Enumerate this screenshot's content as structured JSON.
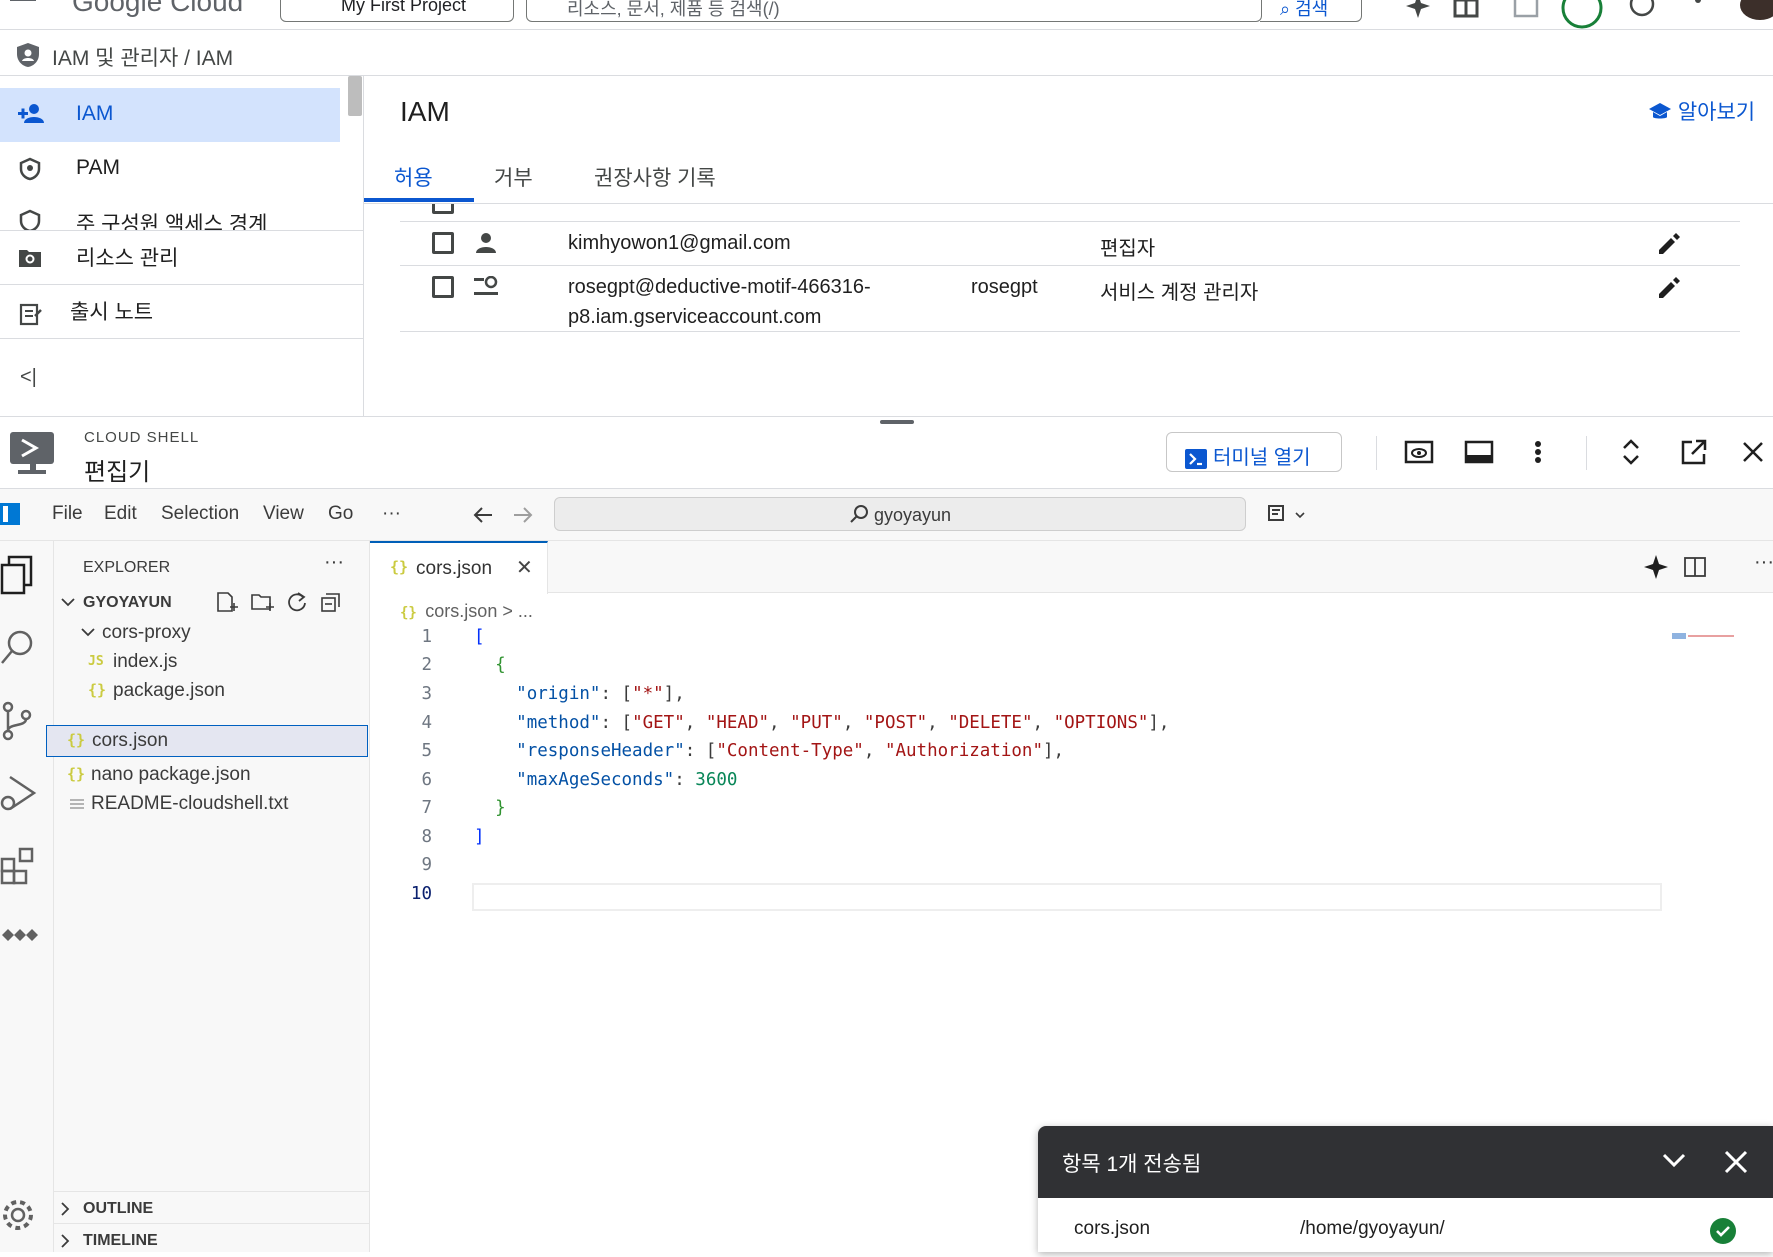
{
  "topbar": {
    "logo": "Google Cloud",
    "project": "My First Project",
    "search_placeholder": "리소스, 문서, 제품 등 검색(/)",
    "search_button": "검색"
  },
  "breadcrumb": {
    "text": "IAM 및 관리자  /  IAM"
  },
  "leftnav": {
    "items": [
      {
        "label": "IAM",
        "icon": "person-add-icon",
        "active": true
      },
      {
        "label": "PAM",
        "icon": "shield-icon"
      },
      {
        "label": "주 구성원 액세스 경계",
        "icon": "shield-person-icon"
      },
      {
        "label": "리소스 관리",
        "icon": "gear-folder-icon"
      },
      {
        "label": "출시 노트",
        "icon": "release-notes-icon"
      }
    ],
    "collapse_label": "<|"
  },
  "iam": {
    "title": "IAM",
    "learn_link": "알아보기",
    "tabs": [
      "허용",
      "거부",
      "권장사항 기록"
    ],
    "rows": [
      {
        "principal": "kimhyowon1@gmail.com",
        "name": "",
        "role": "편집자",
        "type": "person"
      },
      {
        "principal": "rosegpt@deductive-motif-466316-p8.iam.gserviceaccount.com",
        "principal_line1": "rosegpt@deductive-motif-466316-",
        "principal_line2": "p8.iam.gserviceaccount.com",
        "name": "rosegpt",
        "role": "서비스 계정 관리자",
        "type": "service-account"
      }
    ]
  },
  "cloudshell": {
    "label": "CLOUD SHELL",
    "title": "편집기",
    "open_terminal": "터미널 열기"
  },
  "vscode": {
    "menu": [
      "File",
      "Edit",
      "Selection",
      "View",
      "Go",
      "···"
    ],
    "command_center": "gyoyayun",
    "explorer": {
      "title": "EXPLORER",
      "root": "GYOYAYUN",
      "tree": [
        {
          "label": "cors-proxy",
          "kind": "folder",
          "indent": 1
        },
        {
          "label": "index.js",
          "kind": "js",
          "indent": 2
        },
        {
          "label": "package.json",
          "kind": "json",
          "indent": 2
        },
        {
          "label": "cors.json",
          "kind": "json",
          "indent": 1,
          "selected": true
        },
        {
          "label": "nano package.json",
          "kind": "json",
          "indent": 1
        },
        {
          "label": "README-cloudshell.txt",
          "kind": "txt",
          "indent": 1
        }
      ],
      "outline": "OUTLINE",
      "timeline": "TIMELINE"
    },
    "editor": {
      "tab": "cors.json",
      "breadcrumb": "cors.json > ...",
      "current_line": 10,
      "lines": [
        "1",
        "2",
        "3",
        "4",
        "5",
        "6",
        "7",
        "8",
        "9",
        "10"
      ]
    }
  },
  "toast": {
    "title": "항목 1개 전송됨",
    "file": "cors.json",
    "path": "/home/gyoyayun/"
  },
  "colors": {
    "accent": "#0b57d0",
    "active_nav_bg": "#d3e3fd",
    "toast_bg": "#303134",
    "success": "#188038"
  }
}
